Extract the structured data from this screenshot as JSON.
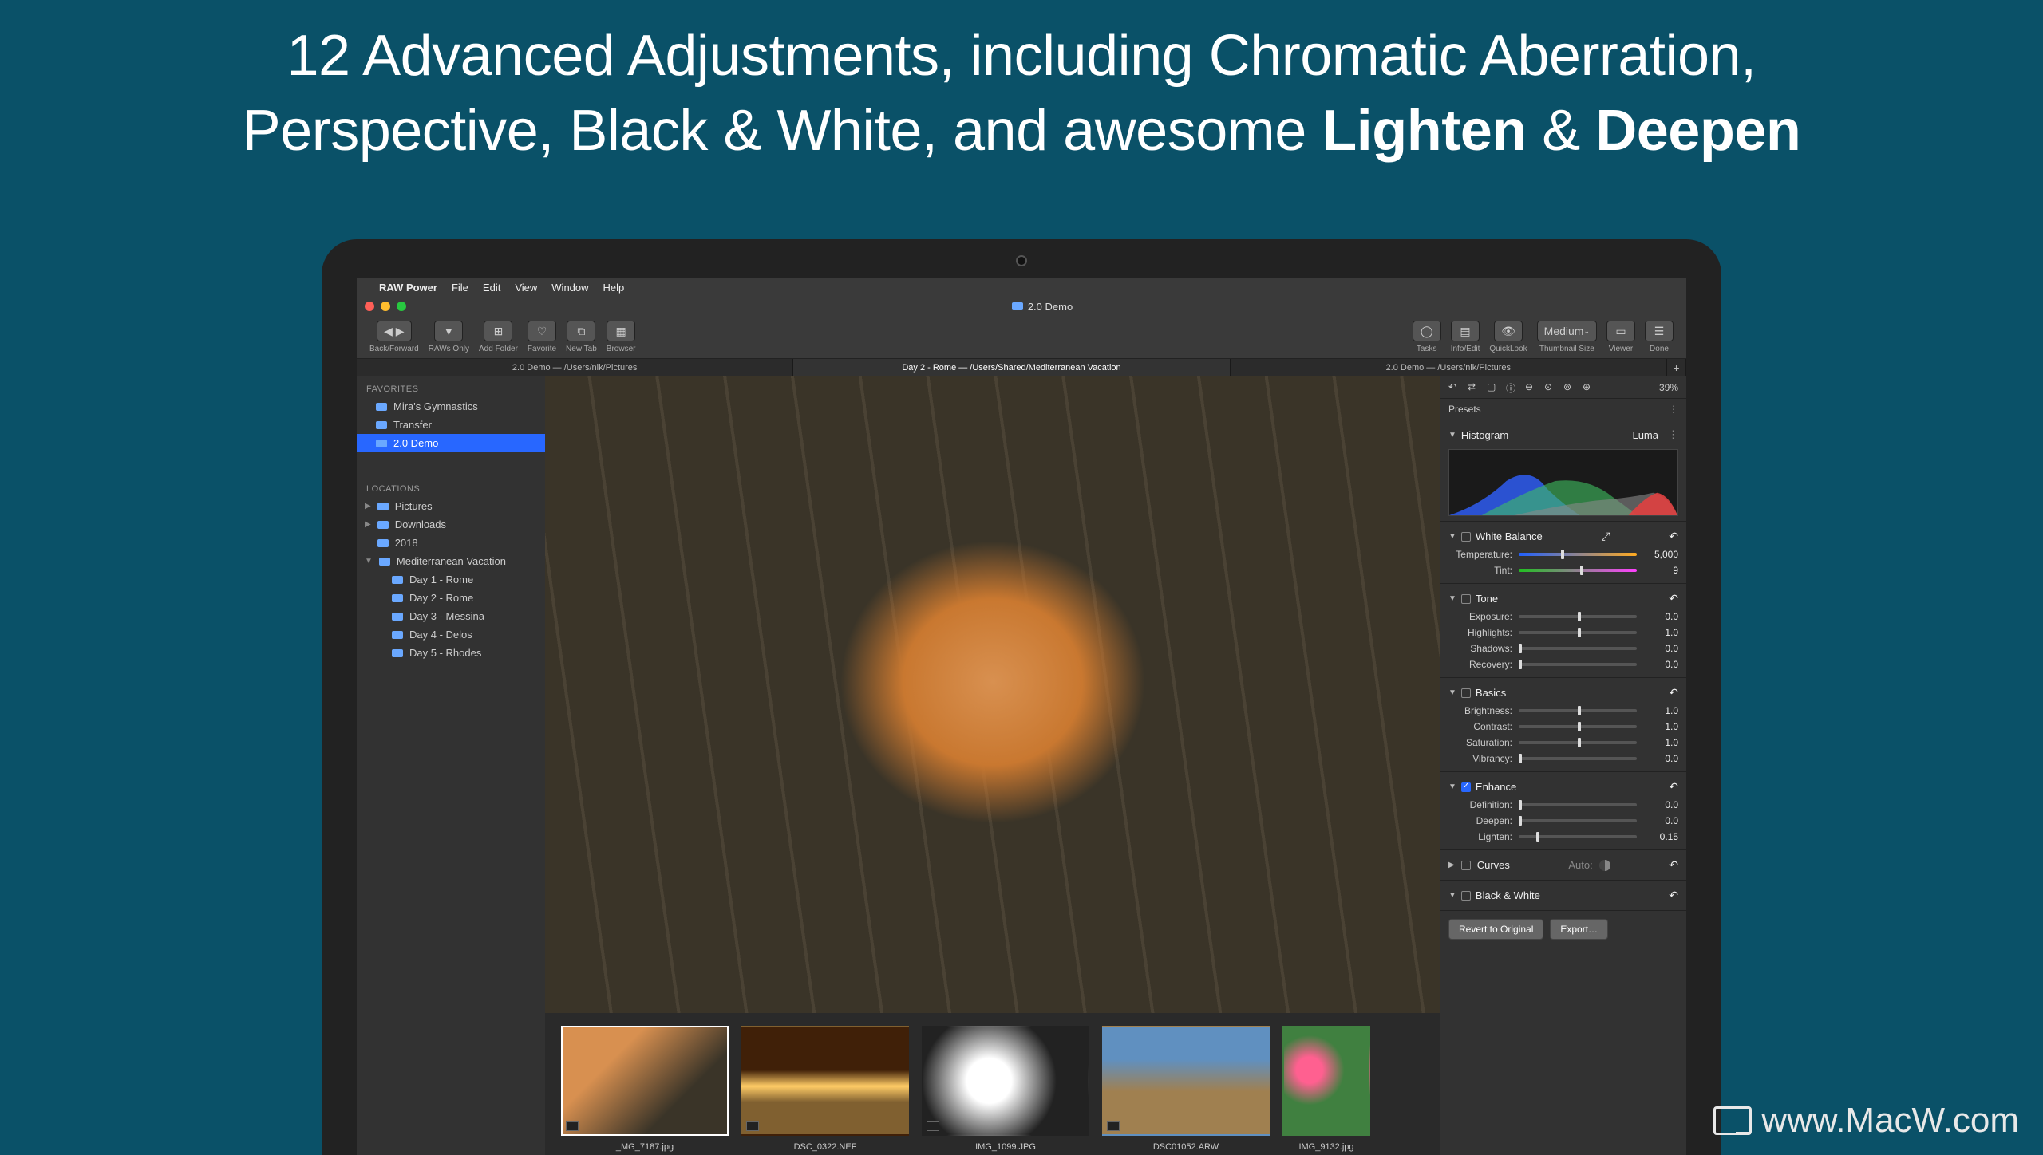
{
  "headline": {
    "line1": "12 Advanced Adjustments, including Chromatic Aberration,",
    "line2_a": "Perspective, Black & White, and awesome ",
    "line2_b1": "Lighten",
    "line2_amp": " & ",
    "line2_b2": "Deepen"
  },
  "menubar": {
    "app": "RAW Power",
    "items": [
      "File",
      "Edit",
      "View",
      "Window",
      "Help"
    ]
  },
  "window": {
    "title": "2.0 Demo"
  },
  "toolbar": {
    "backforward": "Back/Forward",
    "rawsonly": "RAWs Only",
    "addfolder": "Add Folder",
    "favorite": "Favorite",
    "newtab": "New Tab",
    "browser": "Browser",
    "tasks": "Tasks",
    "infoedit": "Info/Edit",
    "quicklook": "QuickLook",
    "thumbsize": "Thumbnail Size",
    "thumbsize_val": "Medium",
    "viewer": "Viewer",
    "done": "Done"
  },
  "tabs": [
    {
      "label": "2.0 Demo  —  /Users/nik/Pictures"
    },
    {
      "label": "Day 2 - Rome  —  /Users/Shared/Mediterranean Vacation"
    },
    {
      "label": "2.0 Demo  —  /Users/nik/Pictures"
    }
  ],
  "sidebar": {
    "favorites_head": "FAVORITES",
    "favorites": [
      "Mira's Gymnastics",
      "Transfer",
      "2.0 Demo"
    ],
    "locations_head": "LOCATIONS",
    "locations": [
      {
        "label": "Pictures",
        "children": []
      },
      {
        "label": "Downloads",
        "children": []
      },
      {
        "label": "2018",
        "children": []
      },
      {
        "label": "Mediterranean Vacation",
        "children": [
          "Day 1 - Rome",
          "Day 2 - Rome",
          "Day 3 - Messina",
          "Day 4 - Delos",
          "Day 5 - Rhodes"
        ]
      }
    ]
  },
  "thumbs": [
    {
      "label": "_MG_7187.jpg"
    },
    {
      "label": "DSC_0322.NEF"
    },
    {
      "label": "IMG_1099.JPG"
    },
    {
      "label": "DSC01052.ARW"
    },
    {
      "label": "IMG_9132.jpg"
    }
  ],
  "inspector": {
    "zoom": "39%",
    "presets": "Presets",
    "histogram": "Histogram",
    "histmode": "Luma",
    "wb": {
      "title": "White Balance",
      "temp_label": "Temperature:",
      "temp": "5,000",
      "tint_label": "Tint:",
      "tint": "9"
    },
    "tone": {
      "title": "Tone",
      "exposure": "Exposure:",
      "exposure_v": "0.0",
      "highlights": "Highlights:",
      "highlights_v": "1.0",
      "shadows": "Shadows:",
      "shadows_v": "0.0",
      "recovery": "Recovery:",
      "recovery_v": "0.0"
    },
    "basics": {
      "title": "Basics",
      "brightness": "Brightness:",
      "brightness_v": "1.0",
      "contrast": "Contrast:",
      "contrast_v": "1.0",
      "saturation": "Saturation:",
      "saturation_v": "1.0",
      "vibrancy": "Vibrancy:",
      "vibrancy_v": "0.0"
    },
    "enhance": {
      "title": "Enhance",
      "definition": "Definition:",
      "definition_v": "0.0",
      "deepen": "Deepen:",
      "deepen_v": "0.0",
      "lighten": "Lighten:",
      "lighten_v": "0.15"
    },
    "curves": {
      "title": "Curves",
      "auto": "Auto:"
    },
    "bw": {
      "title": "Black & White"
    },
    "revert": "Revert to Original",
    "export": "Export…"
  },
  "watermark": "www.MacW.com"
}
